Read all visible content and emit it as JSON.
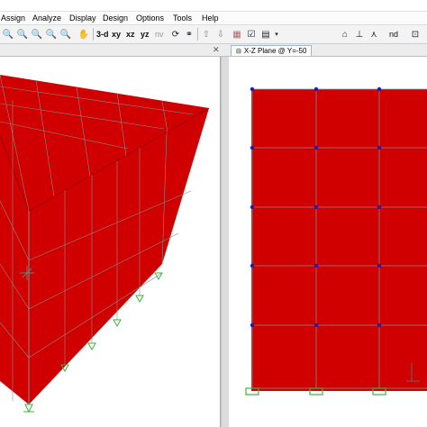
{
  "menu": {
    "items": [
      "Assign",
      "Analyze",
      "Display",
      "Design",
      "Options",
      "Tools",
      "Help"
    ]
  },
  "toolbar": {
    "view_3d": "3-d",
    "view_xy": "xy",
    "view_xz": "xz",
    "view_yz": "yz",
    "view_nv": "nv",
    "right_label": "nd"
  },
  "tabs": {
    "right_title": "X-Z Plane @ Y=-50"
  },
  "model": {
    "fill_color": "#d10000",
    "grid_color": "#8a8a8a",
    "joint_color": "#1d1db5",
    "support_color": "#3cb43c"
  }
}
